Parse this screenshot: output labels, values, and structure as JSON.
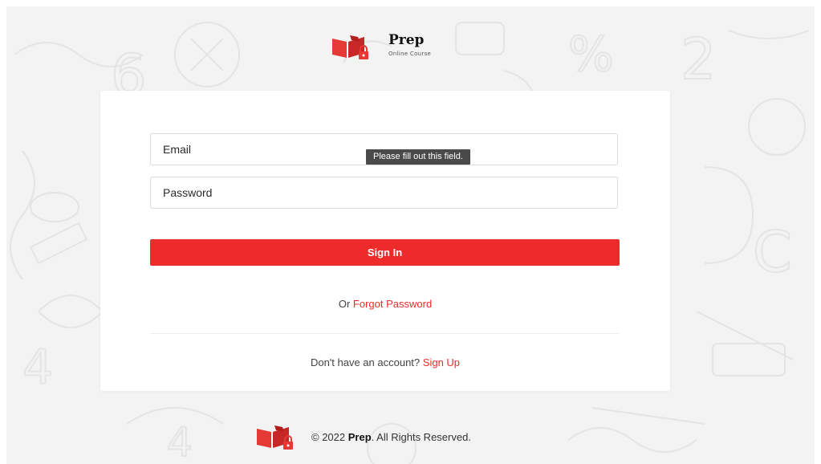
{
  "brand": {
    "name": "Prep",
    "subtitle": "Online Course",
    "logo_icon": "book-with-lock-icon"
  },
  "form": {
    "email_placeholder": "Email",
    "password_placeholder": "Password",
    "validation_tooltip": "Please fill out this field.",
    "signin_label": "Sign In",
    "forgot_prefix": "Or",
    "forgot_link": "Forgot Password",
    "signup_prefix": "Don't have an account?",
    "signup_link": "Sign Up"
  },
  "footer": {
    "copyright": "© 2022",
    "brand": "Prep",
    "suffix": ". All Rights Reserved."
  },
  "colors": {
    "accent": "#ed2b2a",
    "background": "#f3f3f3",
    "card": "#ffffff",
    "tooltip_bg": "#4a4a4a"
  }
}
